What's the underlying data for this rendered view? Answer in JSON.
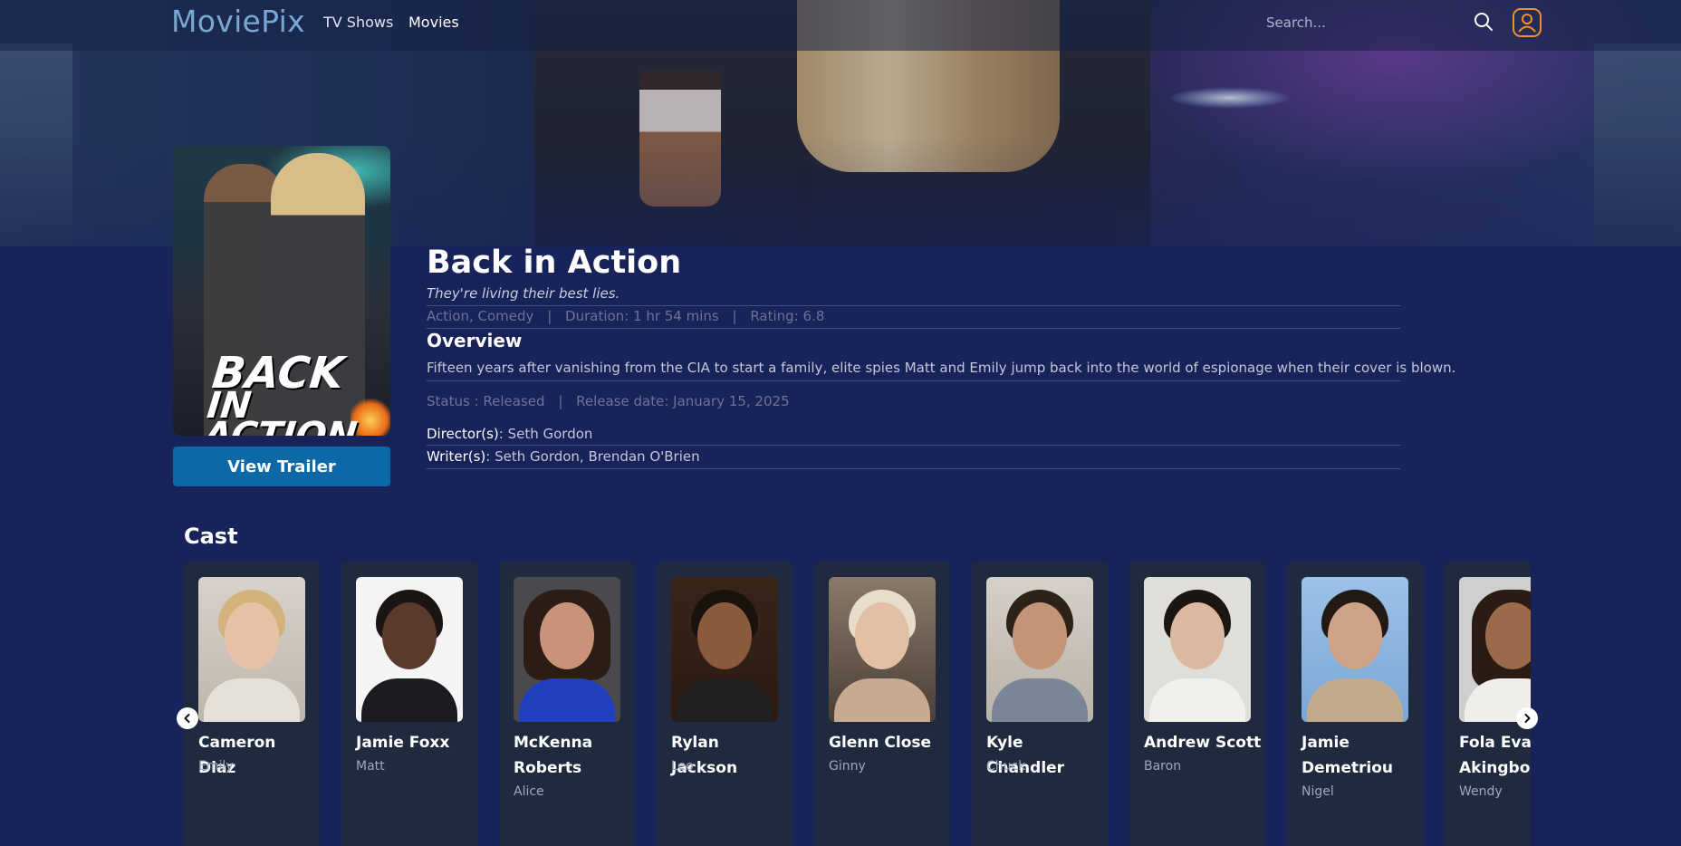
{
  "brand": {
    "logo": "MoviePix"
  },
  "nav": {
    "tv_shows": "TV Shows",
    "movies": "Movies"
  },
  "search": {
    "placeholder": "Search..."
  },
  "movie": {
    "title": "Back in Action",
    "tagline": "They're living their best lies.",
    "genres": "Action, Comedy",
    "duration": "Duration: 1 hr 54 mins",
    "rating": "Rating: 6.8",
    "overview_heading": "Overview",
    "overview": "Fifteen years after vanishing from the CIA to start a family, elite spies Matt and Emily jump back into the world of espionage when their cover is blown.",
    "status": "Status : Released",
    "release_date": "Release date: January 15, 2025",
    "directors_label": "Director(s)",
    "directors": ": Seth Gordon",
    "writers_label": "Writer(s)",
    "writers": ": Seth Gordon, Brendan O'Brien",
    "poster_title_line1": "BACK",
    "poster_title_line2": "IN ACTION",
    "separator": "|"
  },
  "trailer_button": "View Trailer",
  "cast": {
    "heading": "Cast",
    "members": [
      {
        "name": "Cameron Diaz",
        "role": "Emily"
      },
      {
        "name": "Jamie Foxx",
        "role": "Matt"
      },
      {
        "name": "McKenna Roberts",
        "role": "Alice"
      },
      {
        "name": "Rylan Jackson",
        "role": "Leo"
      },
      {
        "name": "Glenn Close",
        "role": "Ginny"
      },
      {
        "name": "Kyle Chandler",
        "role": "Chuck"
      },
      {
        "name": "Andrew Scott",
        "role": "Baron"
      },
      {
        "name": "Jamie Demetriou",
        "role": "Nigel"
      },
      {
        "name": "Fola Evans-Akingbola",
        "role": "Wendy"
      }
    ]
  },
  "colors": {
    "background": "#172359",
    "accent_button": "#0c68a6",
    "user_icon": "#f0931e",
    "logo": "#7aa6d2",
    "card": "#202a3e"
  },
  "icons": {
    "search": "search-icon",
    "user": "user-icon",
    "carousel_prev": "chevron-left-icon",
    "carousel_next": "chevron-right-icon"
  }
}
